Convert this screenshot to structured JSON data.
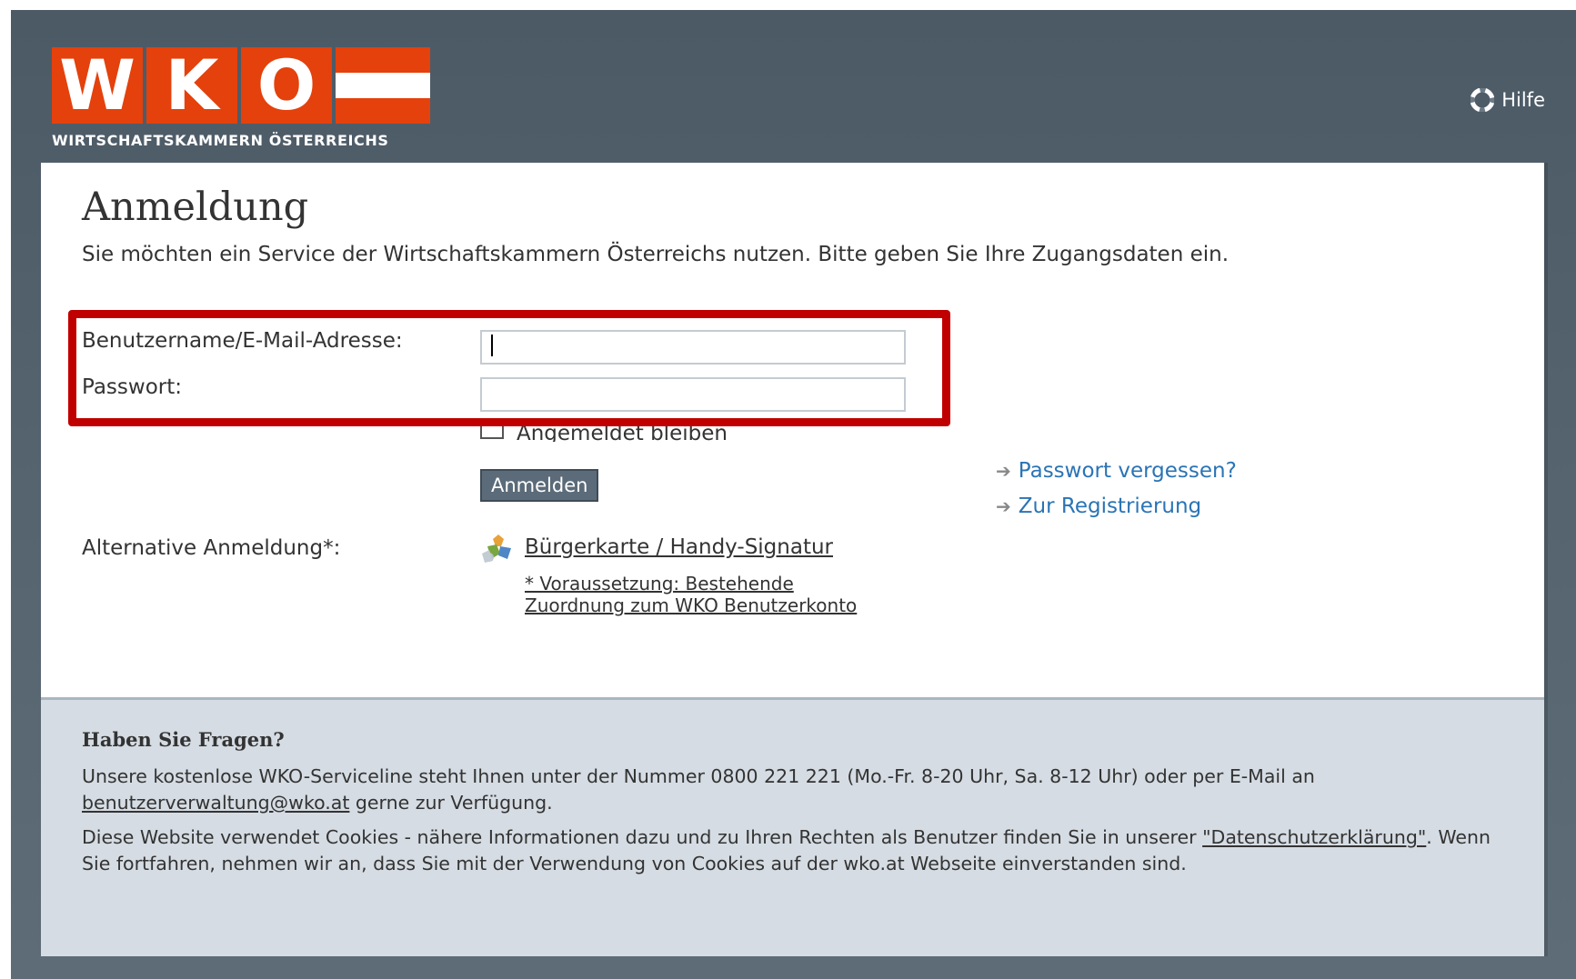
{
  "header": {
    "logo_letters": [
      "W",
      "K",
      "O"
    ],
    "logo_subtitle": "WIRTSCHAFTSKAMMERN ÖSTERREICHS",
    "help_label": "Hilfe",
    "help_icon": "lifebuoy-icon"
  },
  "login": {
    "title": "Anmeldung",
    "intro": "Sie möchten ein Service der Wirtschaftskammern Österreichs nutzen. Bitte geben Sie Ihre Zugangsdaten ein.",
    "username_label": "Benutzername/E-Mail-Adresse:",
    "username_value": "",
    "password_label": "Passwort:",
    "password_value": "",
    "remember_label": "Angemeldet bleiben",
    "remember_checked": false,
    "submit_label": "Anmelden",
    "forgot_password": "Passwort vergessen?",
    "register": "Zur Registrierung",
    "alt_label": "Alternative Anmeldung*:",
    "alt_link": "Bürgerkarte / Handy-Signatur",
    "alt_note_line1": "* Voraussetzung: Bestehende",
    "alt_note_line2": "Zuordnung zum WKO Benutzerkonto"
  },
  "footer": {
    "heading": "Haben Sie Fragen?",
    "p1_before": "Unsere kostenlose WKO-Serviceline steht Ihnen unter der Nummer 0800 221 221 (Mo.-Fr. 8-20 Uhr, Sa. 8-12 Uhr) oder per E-Mail an",
    "p1_email": "benutzerverwaltung@wko.at",
    "p1_after": "gerne zur Verfügung.",
    "p2_before": "Diese Website verwendet Cookies - nähere Informationen dazu und zu Ihren Rechten als Benutzer finden Sie in unserer",
    "p2_link": "\"Datenschutzerklärung\"",
    "p2_after": ". Wenn Sie fortfahren, nehmen wir an, dass Sie mit der Verwendung von Cookies auf der wko.at Webseite einverstanden sind."
  },
  "colors": {
    "brand_orange": "#e4410c",
    "header_bg": "#4c5a66",
    "highlight_red": "#c00000",
    "link_blue": "#2a74b5",
    "footer_bg": "#d5dce3"
  }
}
